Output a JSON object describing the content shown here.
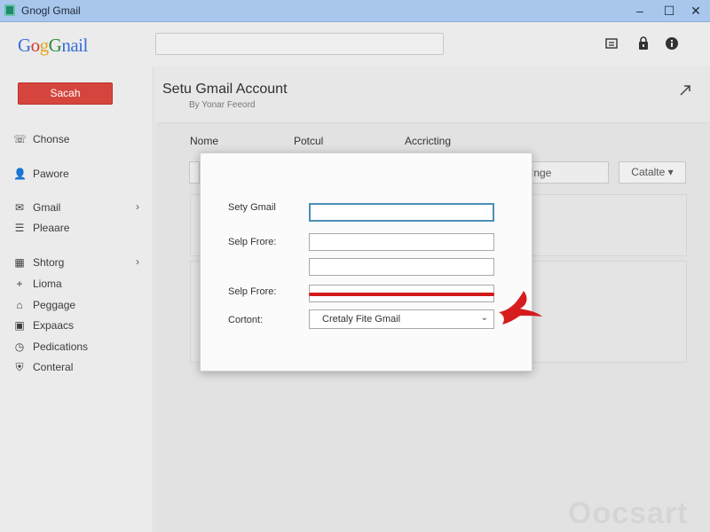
{
  "window": {
    "title": "Gnogl Gmail",
    "minimize_glyph": "–",
    "maximize_glyph": "☐",
    "close_glyph": "✕"
  },
  "header": {
    "logo": {
      "p1": "G",
      "p2": "o",
      "p3": "g",
      "p4": "G",
      "p5": "nail"
    },
    "search_value": "",
    "icons": [
      "document-icon",
      "lock-icon",
      "info-icon"
    ]
  },
  "sidebar": {
    "search_button": "Sacah",
    "items": [
      {
        "label": "Chonse",
        "icon": "phone-icon",
        "glyph": "☏"
      },
      {
        "label": "Pawore",
        "icon": "person-icon",
        "glyph": "👤"
      },
      {
        "label": "Gmail",
        "icon": "mail-icon",
        "glyph": "✉",
        "has_submenu": true
      },
      {
        "label": "Pleaare",
        "icon": "list-icon",
        "glyph": "☰"
      },
      {
        "label": "Shtorg",
        "icon": "grid-icon",
        "glyph": "▦",
        "has_submenu": true
      },
      {
        "label": "Lioma",
        "icon": "plus-icon",
        "glyph": "+"
      },
      {
        "label": "Peggage",
        "icon": "home-icon",
        "glyph": "⌂"
      },
      {
        "label": "Expaacs",
        "icon": "card-icon",
        "glyph": "▣"
      },
      {
        "label": "Pedications",
        "icon": "clock-icon",
        "glyph": "◷"
      },
      {
        "label": "Conteral",
        "icon": "shield-icon",
        "glyph": "⛨"
      }
    ],
    "chevron": "›"
  },
  "main": {
    "title": "Setu Gmail Account",
    "subtitle": "By Yonar Feeord",
    "columns": [
      "Nome",
      "Potcul",
      "Accricting"
    ],
    "bg_field_text": "Inge",
    "bg_button": "Catalte ▾"
  },
  "dialog": {
    "label_1": "Sety Gmail",
    "label_2": "Selp Frore:",
    "label_3": "Selp Frore:",
    "label_4": "Cortont:",
    "select_value": "Cretaly Fite Gmail",
    "select_caret": "⌄"
  },
  "watermark": "Oocsart",
  "colors": {
    "titlebar": "#a9c6ec",
    "accent_red": "#d6453d",
    "annotation_red": "#d11a1a",
    "focus_blue": "#4b8fb6"
  }
}
